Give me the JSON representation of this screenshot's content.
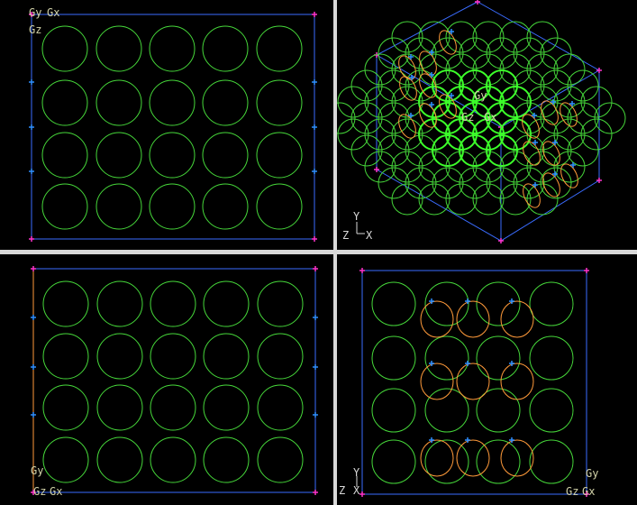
{
  "colors": {
    "background": "#000000",
    "divider": "#d8d8d8",
    "bounding_box": "#3a6cff",
    "corner_marker": "#ff33cc",
    "edge_marker": "#2f8fff",
    "circle_primary": "#46d83a",
    "circle_highlight": "#3cff2a",
    "circle_secondary": "#ff9a3a",
    "label_text": "#d2d2a8",
    "axis_text": "#d8d8d8"
  },
  "viewports": {
    "top_left": {
      "view": "front",
      "gizmo_labels": [
        "Gy",
        "Gx",
        "Gz"
      ]
    },
    "top_right": {
      "view": "isometric",
      "gizmo_labels": [
        "Gy",
        "Gz",
        "Gx"
      ],
      "axis_triad": {
        "y": "Y",
        "z": "Z",
        "x": "X"
      }
    },
    "bottom_left": {
      "view": "side",
      "gizmo_labels": [
        "Gy",
        "Gz",
        "Gx"
      ]
    },
    "bottom_right": {
      "view": "top",
      "gizmo_labels": [
        "Gy",
        "Gz",
        "Gx"
      ],
      "axis_triad": {
        "y": "Y",
        "z": "Z",
        "x": "X"
      }
    }
  }
}
